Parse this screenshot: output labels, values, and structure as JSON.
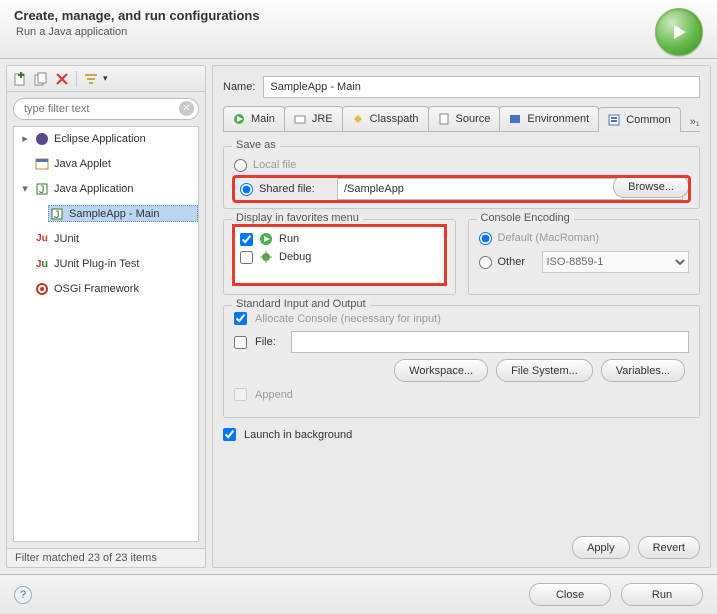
{
  "title": "Create, manage, and run configurations",
  "subtitle": "Run a Java application",
  "filter_placeholder": "type filter text",
  "tree": {
    "eclipse_app": "Eclipse Application",
    "java_applet": "Java Applet",
    "java_app": "Java Application",
    "sample_app": "SampleApp - Main",
    "junit": "JUnit",
    "junit_plugin": "JUnit Plug-in Test",
    "osgi": "OSGi Framework"
  },
  "filter_status": "Filter matched 23 of 23 items",
  "name_label": "Name:",
  "name_value": "SampleApp - Main",
  "tabs": {
    "main": "Main",
    "jre": "JRE",
    "classpath": "Classpath",
    "source": "Source",
    "environment": "Environment",
    "common": "Common",
    "more": "»₁"
  },
  "save_as": {
    "legend": "Save as",
    "local": "Local file",
    "shared": "Shared file:",
    "shared_path": "/SampleApp",
    "browse": "Browse..."
  },
  "fav": {
    "legend": "Display in favorites menu",
    "run": "Run",
    "debug": "Debug"
  },
  "encoding": {
    "legend": "Console Encoding",
    "default": "Default (MacRoman)",
    "other": "Other",
    "value": "ISO-8859-1"
  },
  "stdio": {
    "legend": "Standard Input and Output",
    "allocate": "Allocate Console (necessary for input)",
    "file": "File:",
    "workspace": "Workspace...",
    "filesystem": "File System...",
    "variables": "Variables...",
    "append": "Append"
  },
  "launch_bg": "Launch in background",
  "apply": "Apply",
  "revert": "Revert",
  "close": "Close",
  "run": "Run"
}
